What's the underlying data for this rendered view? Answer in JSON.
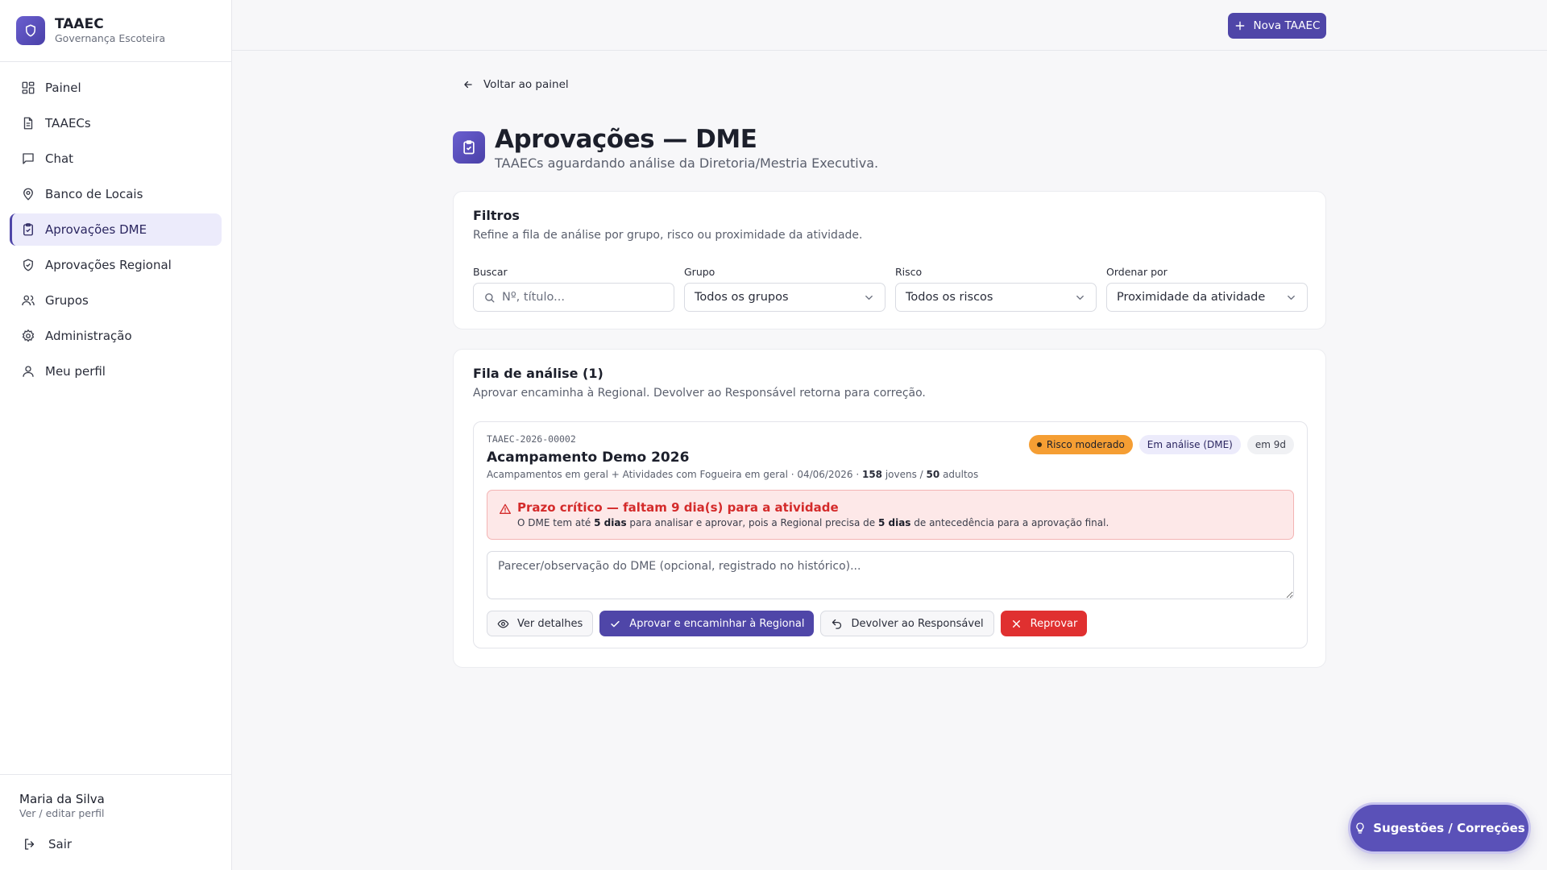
{
  "brand": {
    "title": "TAAEC",
    "subtitle": "Governança Escoteira"
  },
  "sidebar": {
    "items": [
      {
        "label": "Painel",
        "icon": "dashboard-icon"
      },
      {
        "label": "TAAECs",
        "icon": "document-icon"
      },
      {
        "label": "Chat",
        "icon": "chat-icon"
      },
      {
        "label": "Banco de Locais",
        "icon": "map-pin-icon"
      },
      {
        "label": "Aprovações DME",
        "icon": "clipboard-check-icon",
        "active": true
      },
      {
        "label": "Aprovações Regional",
        "icon": "shield-check-icon"
      },
      {
        "label": "Grupos",
        "icon": "users-icon"
      },
      {
        "label": "Administração",
        "icon": "gear-icon"
      },
      {
        "label": "Meu perfil",
        "icon": "user-icon"
      }
    ]
  },
  "user": {
    "name": "Maria da Silva",
    "link": "Ver / editar perfil",
    "logout": "Sair"
  },
  "topbar": {
    "new_button": "Nova TAAEC"
  },
  "page": {
    "back": "Voltar ao painel",
    "title": "Aprovações — DME",
    "subtitle": "TAAECs aguardando análise da Diretoria/Mestria Executiva."
  },
  "filters": {
    "title": "Filtros",
    "description": "Refine a fila de análise por grupo, risco ou proximidade da atividade.",
    "search": {
      "label": "Buscar",
      "placeholder": "Nº, título..."
    },
    "group": {
      "label": "Grupo",
      "value": "Todos os grupos"
    },
    "risk": {
      "label": "Risco",
      "value": "Todos os riscos"
    },
    "sort": {
      "label": "Ordenar por",
      "value": "Proximidade da atividade"
    }
  },
  "queue": {
    "title": "Fila de análise (1)",
    "description": "Aprovar encaminha à Regional. Devolver ao Responsável retorna para correção.",
    "items": [
      {
        "code": "TAAEC-2026-00002",
        "title": "Acampamento Demo 2026",
        "meta_prefix": "Acampamentos em geral + Atividades com Fogueira em geral · 04/06/2026 · ",
        "youth": "158",
        "youth_label": " jovens / ",
        "adults": "50",
        "adults_label": " adultos",
        "badges": {
          "risk": "Risco moderado",
          "status": "Em análise (DME)",
          "days": "em 9d"
        },
        "alert": {
          "title": "Prazo crítico — faltam 9 dia(s) para a atividade",
          "text_1": "O DME tem até ",
          "bold_1": "5 dias",
          "text_2": " para analisar e aprovar, pois a Regional precisa de ",
          "bold_2": "5 dias",
          "text_3": " de antecedência para a aprovação final."
        },
        "note_placeholder": "Parecer/observação do DME (opcional, registrado no histórico)...",
        "actions": {
          "details": "Ver detalhes",
          "approve": "Aprovar e encaminhar à Regional",
          "return": "Devolver ao Responsável",
          "reject": "Reprovar"
        }
      }
    ]
  },
  "fab": {
    "label": "Sugestões / Correções"
  },
  "colors": {
    "accent": "#4f46a8",
    "danger": "#e03030",
    "warning": "#f59e33"
  }
}
